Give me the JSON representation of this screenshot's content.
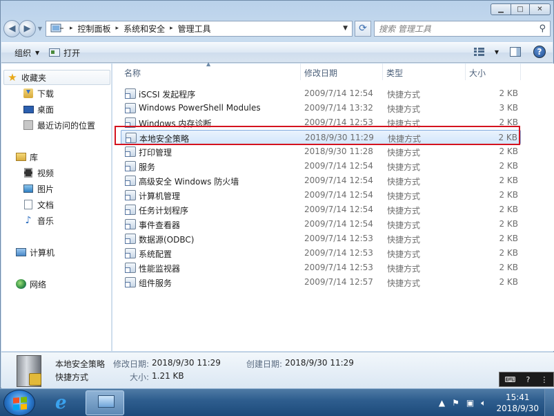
{
  "window": {
    "controls": {
      "minimize": "▁",
      "maximize": "□",
      "close": "✕"
    }
  },
  "address": {
    "crumbs": [
      "控制面板",
      "系统和安全",
      "管理工具"
    ],
    "search_placeholder": "搜索 管理工具"
  },
  "toolbar": {
    "organize": "组织",
    "open": "打开"
  },
  "nav": {
    "favorites": "收藏夹",
    "favorites_items": [
      "下载",
      "桌面",
      "最近访问的位置"
    ],
    "libraries": "库",
    "libraries_items": [
      "视频",
      "图片",
      "文档",
      "音乐"
    ],
    "computer": "计算机",
    "network": "网络"
  },
  "columns": {
    "name": "名称",
    "date": "修改日期",
    "type": "类型",
    "size": "大小"
  },
  "files": [
    {
      "name": "iSCSI 发起程序",
      "date": "2009/7/14 12:54",
      "type": "快捷方式",
      "size": "2 KB"
    },
    {
      "name": "Windows PowerShell Modules",
      "date": "2009/7/14 13:32",
      "type": "快捷方式",
      "size": "3 KB"
    },
    {
      "name": "Windows 内存诊断",
      "date": "2009/7/14 12:53",
      "type": "快捷方式",
      "size": "2 KB"
    },
    {
      "name": "本地安全策略",
      "date": "2018/9/30 11:29",
      "type": "快捷方式",
      "size": "2 KB"
    },
    {
      "name": "打印管理",
      "date": "2018/9/30 11:28",
      "type": "快捷方式",
      "size": "2 KB"
    },
    {
      "name": "服务",
      "date": "2009/7/14 12:54",
      "type": "快捷方式",
      "size": "2 KB"
    },
    {
      "name": "高级安全 Windows 防火墙",
      "date": "2009/7/14 12:54",
      "type": "快捷方式",
      "size": "2 KB"
    },
    {
      "name": "计算机管理",
      "date": "2009/7/14 12:54",
      "type": "快捷方式",
      "size": "2 KB"
    },
    {
      "name": "任务计划程序",
      "date": "2009/7/14 12:54",
      "type": "快捷方式",
      "size": "2 KB"
    },
    {
      "name": "事件查看器",
      "date": "2009/7/14 12:54",
      "type": "快捷方式",
      "size": "2 KB"
    },
    {
      "name": "数据源(ODBC)",
      "date": "2009/7/14 12:53",
      "type": "快捷方式",
      "size": "2 KB"
    },
    {
      "name": "系统配置",
      "date": "2009/7/14 12:53",
      "type": "快捷方式",
      "size": "2 KB"
    },
    {
      "name": "性能监视器",
      "date": "2009/7/14 12:53",
      "type": "快捷方式",
      "size": "2 KB"
    },
    {
      "name": "组件服务",
      "date": "2009/7/14 12:57",
      "type": "快捷方式",
      "size": "2 KB"
    }
  ],
  "details": {
    "name": "本地安全策略",
    "type": "快捷方式",
    "modified_label": "修改日期:",
    "modified_value": "2018/9/30 11:29",
    "created_label": "创建日期:",
    "created_value": "2018/9/30 11:29",
    "size_label": "大小:",
    "size_value": "1.21 KB"
  },
  "taskbar": {
    "time": "15:41",
    "date": "2018/9/30"
  }
}
